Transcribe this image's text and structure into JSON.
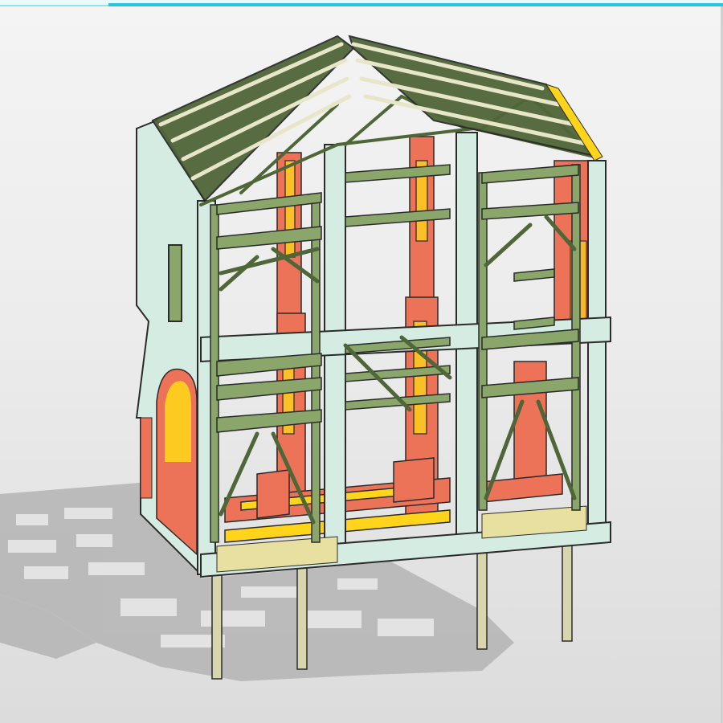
{
  "viewport": {
    "accent_color": "#23c6e0",
    "background_top": "#f4f4f4",
    "background_bottom": "#dcdcdc"
  },
  "model": {
    "colors": {
      "concrete": "#d5ece2",
      "concrete_edge": "#2b2b2b",
      "brick": "#ec7357",
      "brick_highlight": "#ffd41a",
      "steel": "#8aa66a",
      "steel_dark": "#4f6638",
      "roof_beam": "#e8e6c8",
      "pile": "#d8d6ae",
      "shadow": "#b4b4b4"
    }
  }
}
